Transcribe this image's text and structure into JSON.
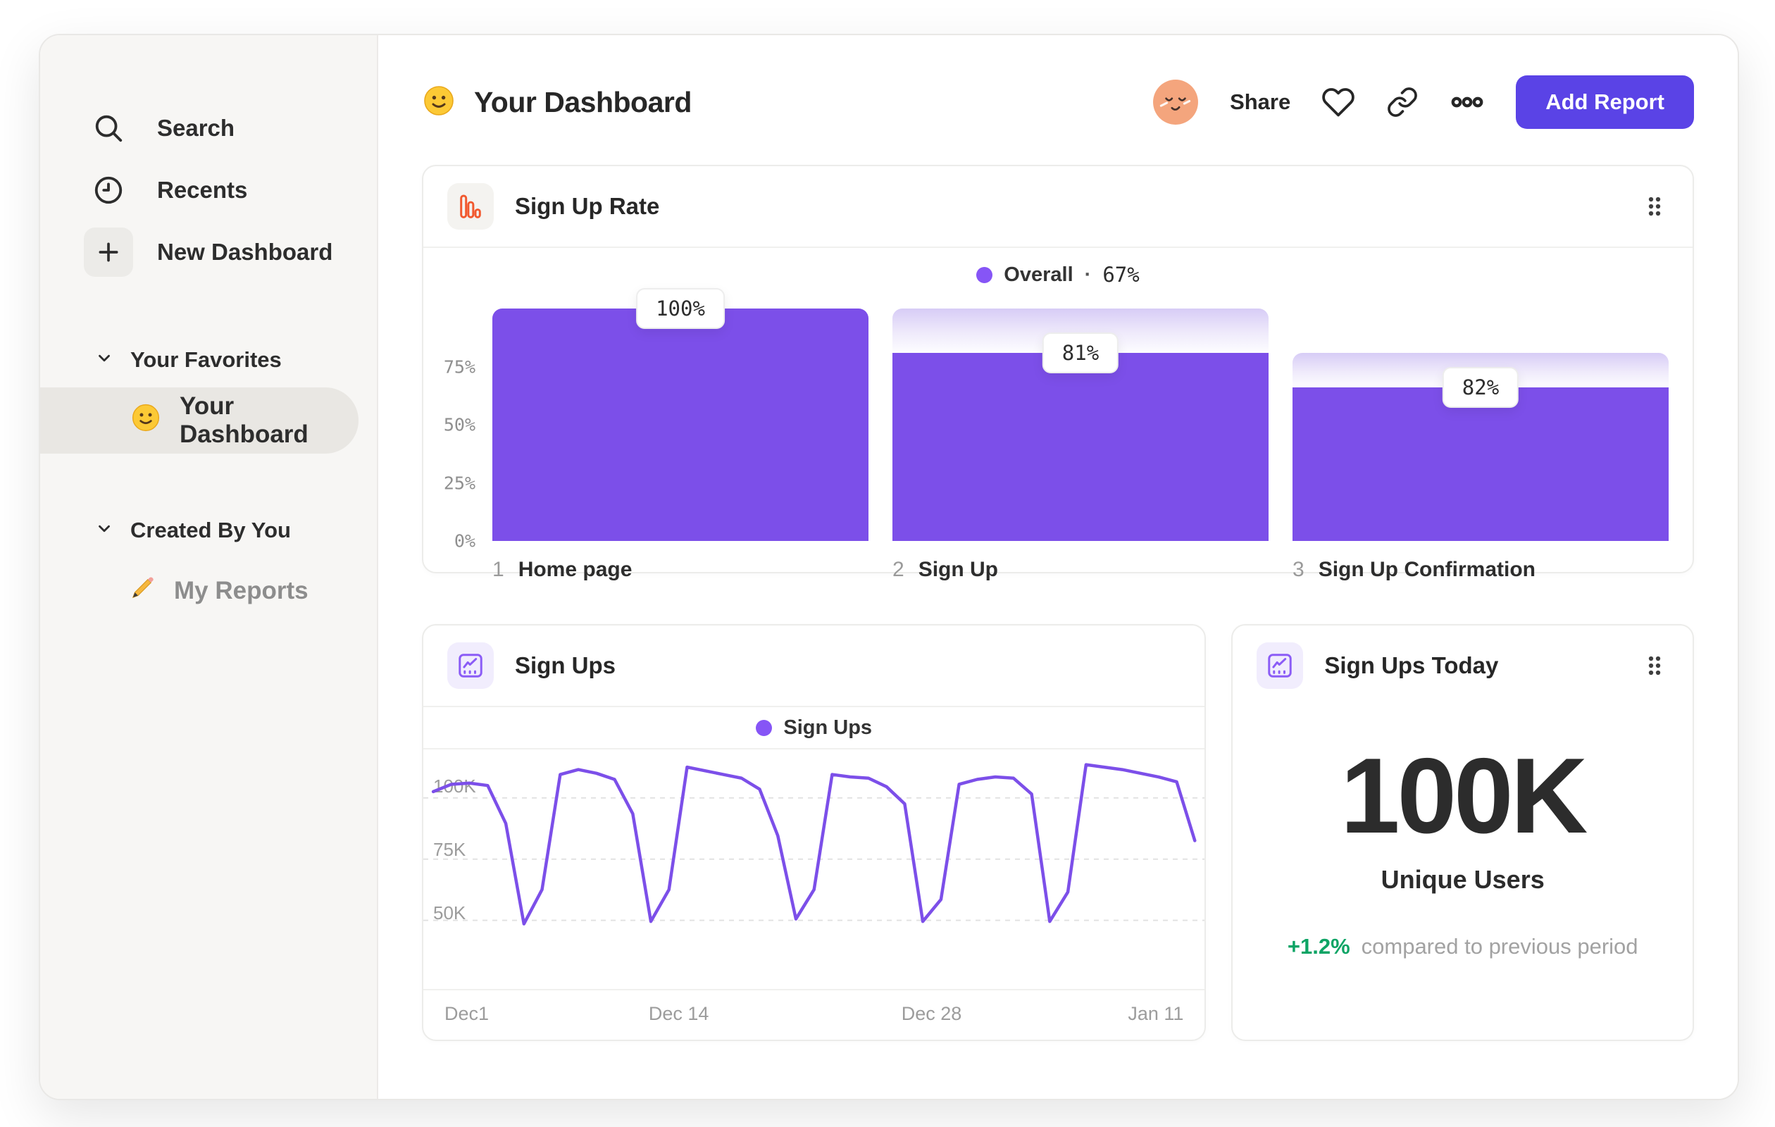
{
  "sidebar": {
    "nav": [
      {
        "icon": "search-icon",
        "label": "Search"
      },
      {
        "icon": "clock-icon",
        "label": "Recents"
      },
      {
        "icon": "plus-icon",
        "label": "New Dashboard"
      }
    ],
    "sections": [
      {
        "label": "Your Favorites",
        "items": [
          {
            "emoji": "smiley-face",
            "label": "Your Dashboard",
            "selected": true
          }
        ]
      },
      {
        "label": "Created By You",
        "items": [
          {
            "emoji": "pencil",
            "label": "My Reports",
            "selected": false
          }
        ]
      }
    ]
  },
  "header": {
    "emoji": "smiley-face",
    "title": "Your Dashboard",
    "share_label": "Share",
    "add_report_label": "Add Report"
  },
  "chart_data": [
    {
      "type": "bar",
      "subtype": "funnel",
      "title": "Sign Up Rate",
      "legend": {
        "name": "Overall",
        "sep": "·",
        "value_label": "67%",
        "position": "top-center"
      },
      "y_ticks": [
        "0%",
        "25%",
        "50%",
        "75%"
      ],
      "ylim": [
        0,
        100
      ],
      "grid": "off",
      "steps": [
        {
          "index": "1",
          "label": "Home page",
          "badge": "100%",
          "conversion_from_previous_pct": 100,
          "cumulative_pct": 100
        },
        {
          "index": "2",
          "label": "Sign Up",
          "badge": "81%",
          "conversion_from_previous_pct": 81,
          "cumulative_pct": 81
        },
        {
          "index": "3",
          "label": "Sign Up Confirmation",
          "badge": "82%",
          "conversion_from_previous_pct": 82,
          "cumulative_pct": 66
        }
      ]
    },
    {
      "type": "line",
      "title": "Sign Ups",
      "legend_position": "top-center",
      "grid": "dashed-horizontal",
      "unit": "K users per day",
      "x_range": "Dec 1 - Jan 11",
      "x_ticks": [
        {
          "label": "Dec1",
          "frac": 0
        },
        {
          "label": "Dec 14",
          "frac": 0.317
        },
        {
          "label": "Dec 28",
          "frac": 0.659
        },
        {
          "label": "Jan 11",
          "frac": 1
        }
      ],
      "y_ticks": [
        {
          "label": "50K",
          "value": 50
        },
        {
          "label": "75K",
          "value": 75
        },
        {
          "label": "100K",
          "value": 100
        }
      ],
      "series": [
        {
          "name": "Sign Ups",
          "values": [
            97,
            100,
            100.5,
            99.5,
            84,
            43,
            57,
            104,
            106,
            104.5,
            102,
            88,
            44,
            57,
            107,
            105.5,
            104,
            102.5,
            98,
            79,
            45,
            57,
            104,
            103,
            102.5,
            99,
            92,
            44,
            53,
            100,
            102,
            103,
            102.5,
            96,
            44,
            56,
            108,
            107,
            106,
            104.5,
            103,
            101,
            77
          ]
        }
      ]
    },
    {
      "type": "metric",
      "title": "Sign Ups Today",
      "value": "100K",
      "label": "Unique Users",
      "delta": "+1.2%",
      "delta_note": "compared to previous period"
    }
  ],
  "colors": {
    "bar_purple": "#7c4fe9",
    "legend_dot_purple": "#8655f6",
    "button_purple": "#5a43e6",
    "positive_green": "#0da465",
    "funnel_icon_orange": "#f1592f",
    "line_icon_purple": "#8b5cf6",
    "avatar_orange": "#f4a57d"
  }
}
